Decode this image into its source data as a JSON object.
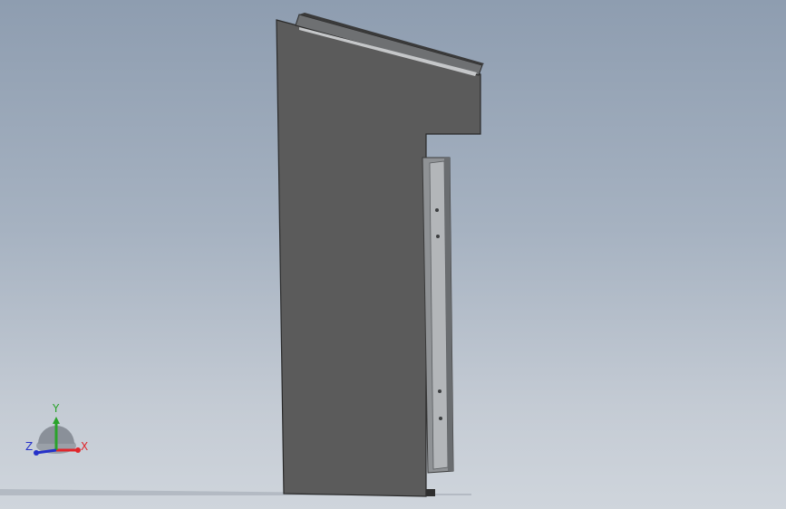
{
  "scene": {
    "model": "sheet-metal-enclosure-side-view",
    "colors": {
      "background_top": "#8e9db0",
      "background_bottom": "#cfd5dc",
      "panel_face": "#5b5b5b",
      "panel_edge": "#2a2a2a",
      "rail_light": "#b5b8bb",
      "rail_dark": "#7a7d80"
    }
  },
  "triad": {
    "x_label": "X",
    "y_label": "Y",
    "z_label": "Z",
    "x_color": "#e0262b",
    "y_color": "#2aa32a",
    "z_color": "#2531c9"
  }
}
